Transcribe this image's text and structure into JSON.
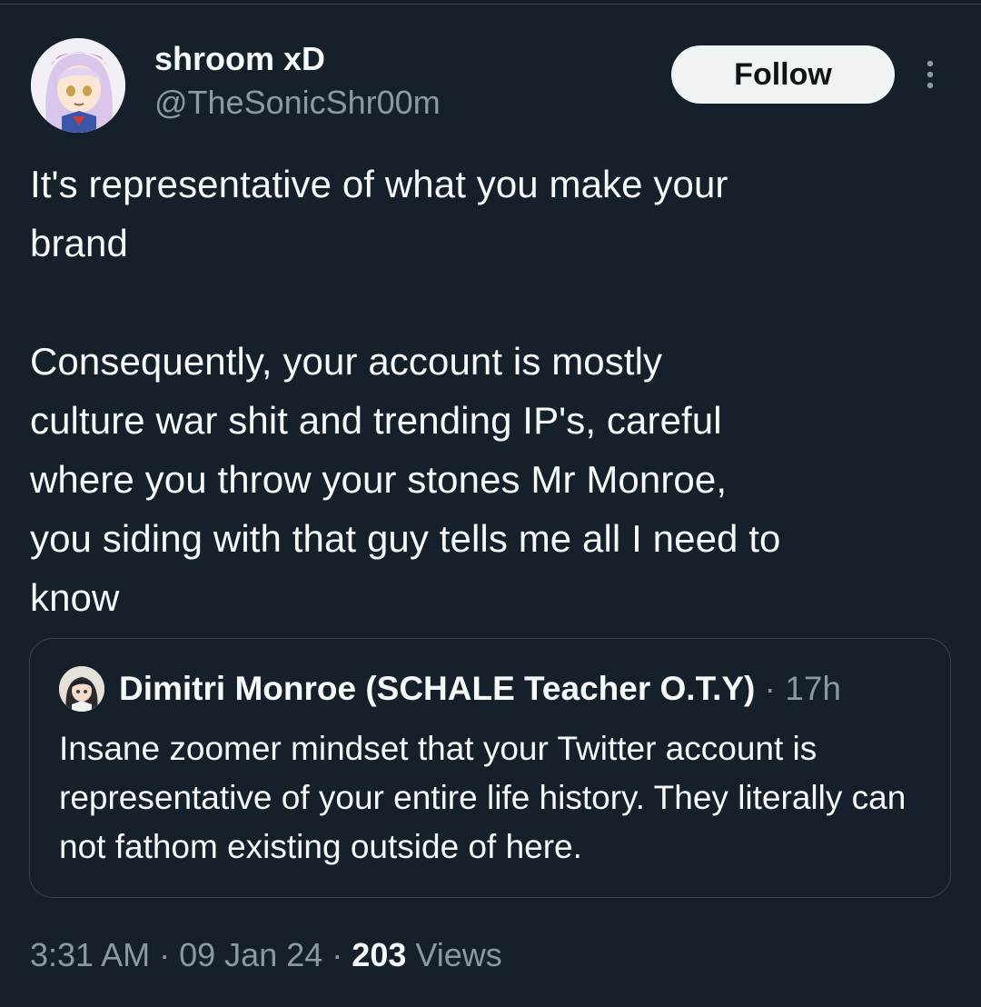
{
  "author": {
    "display_name": "shroom xD",
    "handle": "@TheSonicShr00m",
    "avatar_icon": "anime-girl-avatar"
  },
  "actions": {
    "follow_label": "Follow",
    "more_icon": "more-vertical-icon"
  },
  "tweet": {
    "text": "It's representative of what you make your\nbrand\n\nConsequently, your account is mostly\nculture war shit and trending IP's, careful\nwhere you throw your stones Mr Monroe,\nyou siding with that guy tells me all I need to\nknow"
  },
  "quoted_tweet": {
    "display_name": "Dimitri Monroe (SCHALE Teacher O.T.Y)",
    "separator": "·",
    "time": "17h",
    "avatar_icon": "anime-character-avatar",
    "text": "Insane zoomer mindset that your Twitter account is representative of your entire life history. They literally can not fathom existing outside of here."
  },
  "meta": {
    "time": "3:31 AM",
    "separator": "·",
    "date": "09 Jan 24",
    "views_count": "203",
    "views_label": "Views"
  },
  "colors": {
    "background": "#15202b",
    "text_primary": "#f7f9f9",
    "text_secondary": "#8b98a5",
    "border": "#38444d",
    "button_bg": "#eff3f4"
  }
}
